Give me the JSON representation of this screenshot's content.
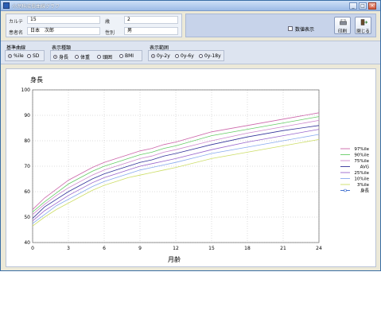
{
  "window": {
    "title": "小児科成長曲線グラフ",
    "minimize": "_",
    "maximize": "□",
    "close": "×"
  },
  "info": {
    "karte_label": "カルテ",
    "karte_value": "15",
    "age_label": "歳",
    "age_value": "2",
    "name_label": "患者名",
    "name_value": "日本　次郎",
    "sex_label": "性別",
    "sex_value": "男"
  },
  "toolbar": {
    "show_values_label": "数値表示",
    "print_label": "印刷",
    "close_label": "閉じる"
  },
  "options": {
    "baseline": {
      "title": "基準曲線",
      "items": [
        {
          "label": "%ile",
          "selected": true
        },
        {
          "label": "SD",
          "selected": false
        }
      ]
    },
    "display_type": {
      "title": "表示種類",
      "items": [
        {
          "label": "身長",
          "selected": true
        },
        {
          "label": "体重",
          "selected": false
        },
        {
          "label": "頭囲",
          "selected": false
        },
        {
          "label": "BMI",
          "selected": false
        }
      ]
    },
    "display_range": {
      "title": "表示範囲",
      "items": [
        {
          "label": "0y-2y",
          "selected": true
        },
        {
          "label": "0y-6y",
          "selected": false
        },
        {
          "label": "0y-18y",
          "selected": false
        }
      ]
    }
  },
  "chart_data": {
    "type": "line",
    "title": "身長",
    "xlabel": "月齢",
    "ylabel": "",
    "xlim": [
      0,
      24
    ],
    "ylim": [
      40,
      100
    ],
    "xticks": [
      0,
      3,
      6,
      9,
      12,
      15,
      18,
      21,
      24
    ],
    "yticks": [
      40,
      50,
      60,
      70,
      80,
      90,
      100
    ],
    "grid": true,
    "legend_position": "right",
    "x": [
      0,
      1,
      2,
      3,
      4,
      5,
      6,
      7,
      8,
      9,
      10,
      11,
      12,
      15,
      18,
      21,
      24
    ],
    "series": [
      {
        "name": "97%ile",
        "color": "#cc66aa",
        "values": [
          53.0,
          57.5,
          61.0,
          64.5,
          67.0,
          69.5,
          71.5,
          73.0,
          74.5,
          76.0,
          77.0,
          78.5,
          79.5,
          83.5,
          86.0,
          88.5,
          91.0
        ]
      },
      {
        "name": "90%ile",
        "color": "#66cc66",
        "values": [
          52.0,
          56.0,
          59.5,
          63.0,
          65.5,
          68.0,
          70.0,
          71.5,
          73.0,
          74.5,
          75.5,
          77.0,
          78.0,
          82.0,
          84.5,
          87.0,
          89.5
        ]
      },
      {
        "name": "75%ile",
        "color": "#cc88cc",
        "values": [
          51.0,
          55.0,
          58.5,
          61.5,
          64.0,
          66.5,
          68.5,
          70.0,
          71.5,
          73.0,
          74.0,
          75.5,
          76.5,
          80.0,
          83.0,
          85.5,
          88.0
        ]
      },
      {
        "name": "AVG",
        "color": "#333399",
        "values": [
          49.5,
          54.0,
          57.0,
          60.0,
          62.5,
          65.0,
          67.0,
          68.5,
          70.0,
          71.5,
          72.5,
          74.0,
          75.0,
          78.5,
          81.5,
          84.0,
          86.0
        ]
      },
      {
        "name": "25%ile",
        "color": "#9966cc",
        "values": [
          48.5,
          52.5,
          55.5,
          58.5,
          61.0,
          63.5,
          65.5,
          67.0,
          68.5,
          70.0,
          71.0,
          72.0,
          73.0,
          76.5,
          79.5,
          82.0,
          84.5
        ]
      },
      {
        "name": "10%ile",
        "color": "#88aaee",
        "values": [
          47.5,
          51.0,
          54.5,
          57.0,
          59.5,
          62.0,
          64.0,
          65.5,
          67.0,
          68.5,
          69.5,
          70.5,
          71.5,
          75.0,
          77.5,
          80.0,
          82.5
        ]
      },
      {
        "name": "3%ile",
        "color": "#ccdd66",
        "values": [
          46.5,
          50.0,
          53.0,
          55.5,
          58.0,
          60.5,
          62.5,
          64.0,
          65.5,
          66.5,
          67.5,
          68.5,
          69.5,
          73.0,
          75.5,
          78.0,
          80.5
        ]
      }
    ],
    "patient_series": {
      "name": "身長",
      "color": "#3366cc",
      "values": []
    }
  }
}
